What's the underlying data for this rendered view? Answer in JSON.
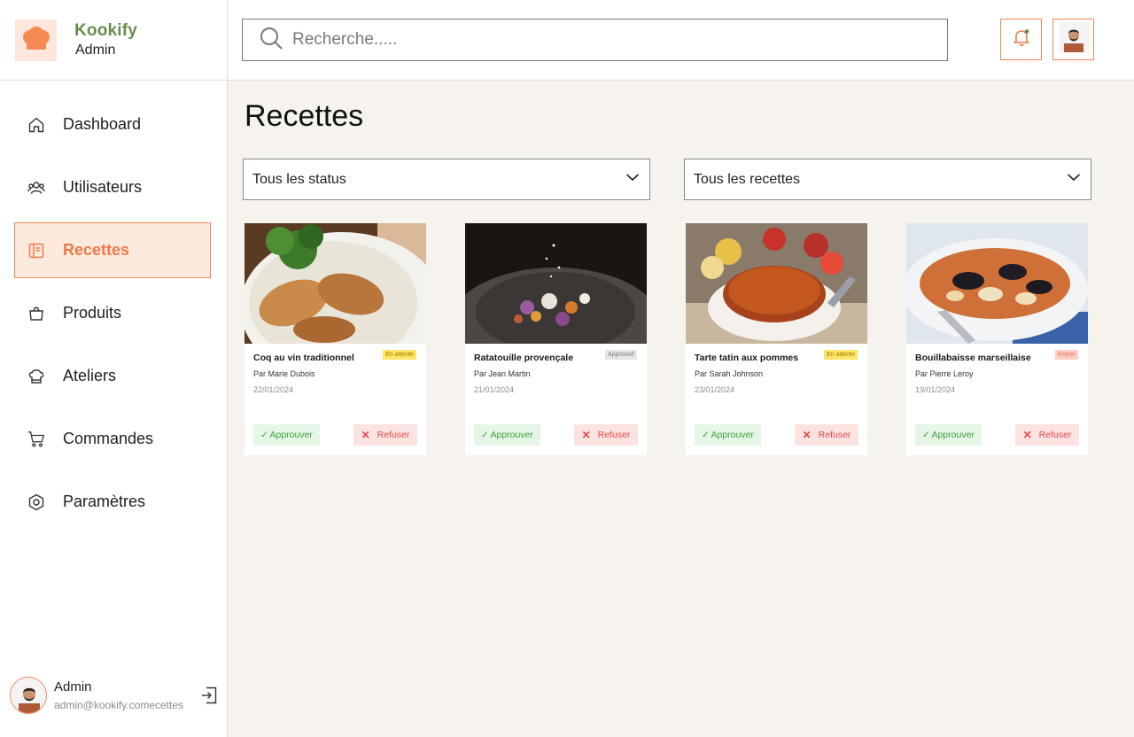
{
  "brand": {
    "name": "Kookify",
    "role": "Admin"
  },
  "search": {
    "placeholder": "Recherche....."
  },
  "sidebar": {
    "items": [
      {
        "label": "Dashboard",
        "icon": "home-icon",
        "active": false
      },
      {
        "label": "Utilisateurs",
        "icon": "users-icon",
        "active": false
      },
      {
        "label": "Recettes",
        "icon": "book-icon",
        "active": true
      },
      {
        "label": "Produits",
        "icon": "bag-icon",
        "active": false
      },
      {
        "label": "Ateliers",
        "icon": "chef-hat-icon",
        "active": false
      },
      {
        "label": "Commandes",
        "icon": "cart-icon",
        "active": false
      },
      {
        "label": "Paramètres",
        "icon": "settings-icon",
        "active": false
      }
    ],
    "user": {
      "name": "Admin",
      "email": "admin@kookify.comecettes"
    }
  },
  "page": {
    "title": "Recettes"
  },
  "filters": {
    "status": {
      "value": "Tous les status"
    },
    "recipes": {
      "value": "Tous les recettes"
    }
  },
  "cards": [
    {
      "title": "Coq au vin traditionnel",
      "author": "Par Marie Dubois",
      "date": "22/01/2024",
      "status": "En attente",
      "status_type": "pending",
      "approve": "Approuver",
      "refuse": "Refuser"
    },
    {
      "title": "Ratatouille provençale",
      "author": "Par Jean Martin",
      "date": "21/01/2024",
      "status": "Approuvé",
      "status_type": "approved",
      "approve": "Approuver",
      "refuse": "Refuser"
    },
    {
      "title": "Tarte tatin aux pommes",
      "author": "Par Sarah Johnson",
      "date": "23/01/2024",
      "status": "En attente",
      "status_type": "pending",
      "approve": "Approuver",
      "refuse": "Refuser"
    },
    {
      "title": "Bouillabaisse marseillaise",
      "author": "Par Pierre Leroy",
      "date": "19/01/2024",
      "status": "Rejeté",
      "status_type": "rejected",
      "approve": "Approuver",
      "refuse": "Refuser"
    }
  ],
  "colors": {
    "accent": "#ee7a45",
    "brand_green": "#6b8a4e",
    "background": "#f6f3ee"
  }
}
